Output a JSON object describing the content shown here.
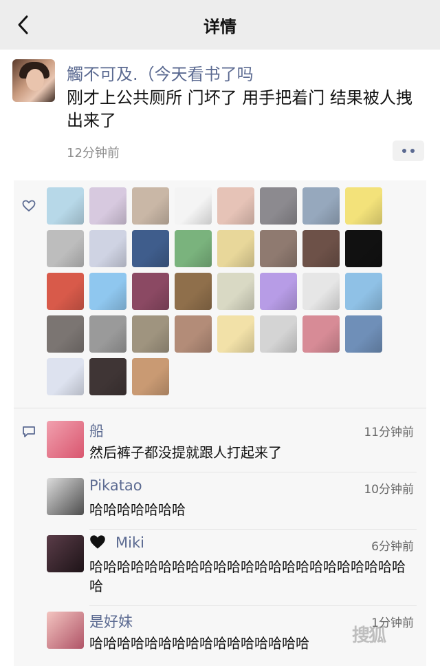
{
  "nav": {
    "title": "详情",
    "back_icon": "chevron-left-icon"
  },
  "post": {
    "author": "觸不可及.（今天看书了吗",
    "content": "刚才上公共厕所 门坏了 用手把着门 结果被人拽出来了",
    "time": "12分钟前",
    "more_icon": "more-dots-icon"
  },
  "likes": {
    "icon": "heart-outline-icon",
    "avatars": [
      "#b7d8e8",
      "#d7c9df",
      "#c9b7a6",
      "#f4f4f4",
      "#e6c3b7",
      "#8c8a8f",
      "#96a8bd",
      "#f3e27a",
      "#bdbdbd",
      "#cfd3e3",
      "#3f5d8c",
      "#7ab37d",
      "#e8d79a",
      "#8f7a70",
      "#6d5148",
      "#111111",
      "#d85a4a",
      "#8fc7ef",
      "#8b4963",
      "#8f6f4b",
      "#d9d9c4",
      "#b79ce6",
      "#e6e6e6",
      "#8fc1e6",
      "#7b7572",
      "#9a9a9a",
      "#9f947f",
      "#b38c78",
      "#f2e1a8",
      "#d4d4d4",
      "#d78b96",
      "#6f8fb8",
      "#dde2ef",
      "#3f3535",
      "#c99a73"
    ]
  },
  "comments_icon": "comment-bubble-icon",
  "comments": [
    {
      "name": "船",
      "time": "11分钟前",
      "text": "然后裤子都没提就跟人打起来了",
      "avatar_color": "#e0788e"
    },
    {
      "name": "Pikatao",
      "time": "10分钟前",
      "text": "哈哈哈哈哈哈哈",
      "avatar_color": "#6a6a6a"
    },
    {
      "name": "Miki",
      "time": "6分钟前",
      "text": "哈哈哈哈哈哈哈哈哈哈哈哈哈哈哈哈哈哈哈哈哈哈哈哈",
      "avatar_color": "#3a2a33",
      "emoji": "black-heart-icon"
    },
    {
      "name": "是好妹",
      "time": "1分钟前",
      "text": "哈哈哈哈哈哈哈哈哈哈哈哈哈哈哈哈",
      "avatar_color": "#d58a8f"
    }
  ],
  "watermark": "搜狐"
}
